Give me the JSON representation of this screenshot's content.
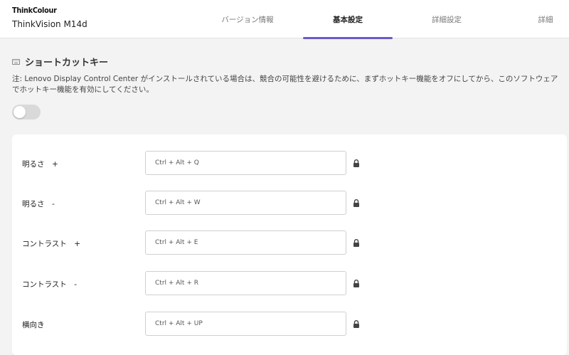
{
  "header": {
    "brand": "ThinkColour",
    "product": "ThinkVision M14d",
    "tabs": [
      {
        "label": "バージョン情報",
        "active": false
      },
      {
        "label": "基本設定",
        "active": true
      },
      {
        "label": "詳細設定",
        "active": false
      },
      {
        "label": "詳細",
        "active": false
      }
    ],
    "accent_color": "#6a5acd"
  },
  "section": {
    "icon": "keyboard-icon",
    "title": "ショートカットキー",
    "note": "注: Lenovo Display Control Center がインストールされている場合は、競合の可能性を避けるために、まずホットキー機能をオフにしてから、このソフトウェアでホットキー機能を有効にしてください。",
    "hotkey_enabled": false
  },
  "shortcuts": [
    {
      "label": "明るさ　+",
      "value": "Ctrl + Alt + Q"
    },
    {
      "label": "明るさ　-",
      "value": "Ctrl + Alt + W"
    },
    {
      "label": "コントラスト　+",
      "value": "Ctrl + Alt + E"
    },
    {
      "label": "コントラスト　-",
      "value": "Ctrl + Alt + R"
    },
    {
      "label": "横向き",
      "value": "Ctrl + Alt + UP"
    }
  ]
}
